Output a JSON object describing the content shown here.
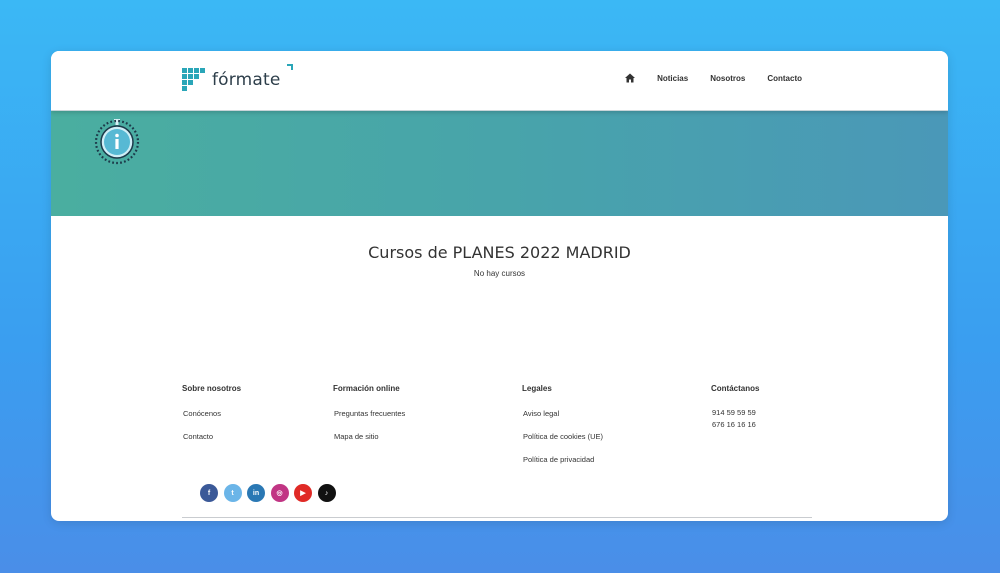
{
  "header": {
    "logo_text": "fórmate",
    "nav": [
      {
        "label": "Noticias"
      },
      {
        "label": "Nosotros"
      },
      {
        "label": "Contacto"
      }
    ]
  },
  "main": {
    "title": "Cursos de PLANES 2022 MADRID",
    "empty_message": "No hay cursos"
  },
  "footer": {
    "about": {
      "heading": "Sobre nosotros",
      "links": [
        "Conócenos",
        "Contacto"
      ]
    },
    "online": {
      "heading": "Formación online",
      "links": [
        "Preguntas frecuentes",
        "Mapa de sitio"
      ]
    },
    "legal": {
      "heading": "Legales",
      "links": [
        "Aviso legal",
        "Política de cookies (UE)",
        "Política de privacidad"
      ]
    },
    "contact": {
      "heading": "Contáctanos",
      "phones": [
        "914 59 59 59",
        "676 16 16 16"
      ]
    },
    "socials": [
      {
        "name": "facebook-icon",
        "glyph": "f",
        "color": "#3b5998"
      },
      {
        "name": "twitter-icon",
        "glyph": "t",
        "color": "#6bb5e8"
      },
      {
        "name": "linkedin-icon",
        "glyph": "in",
        "color": "#2a78b4"
      },
      {
        "name": "instagram-icon",
        "glyph": "◎",
        "color": "#c13584"
      },
      {
        "name": "youtube-icon",
        "glyph": "▶",
        "color": "#e02a26"
      },
      {
        "name": "tiktok-icon",
        "glyph": "♪",
        "color": "#111111"
      }
    ]
  },
  "colors": {
    "brand": "#2aa6b8",
    "banner_start": "#4aaea0",
    "banner_end": "#4a98b8"
  }
}
